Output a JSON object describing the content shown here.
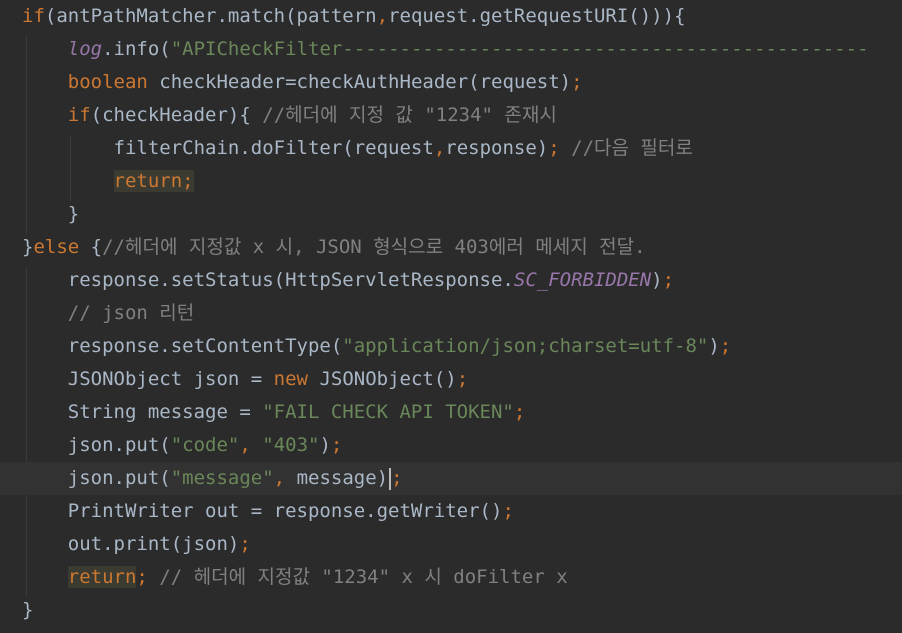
{
  "code_editor": {
    "lines": [
      {
        "tokens": [
          {
            "t": "if",
            "c": "kw"
          },
          {
            "t": "(antPathMatcher.match(pattern",
            "c": ""
          },
          {
            "t": ",",
            "c": "punct"
          },
          {
            "t": "request.getRequestURI())){",
            "c": ""
          }
        ]
      },
      {
        "tokens": [
          {
            "t": "    "
          },
          {
            "t": "log",
            "c": "fld"
          },
          {
            "t": ".info("
          },
          {
            "t": "\"APICheckFilter----------------------------------------------",
            "c": "str"
          }
        ]
      },
      {
        "tokens": [
          {
            "t": "    "
          },
          {
            "t": "boolean",
            "c": "kw"
          },
          {
            "t": " checkHeader=checkAuthHeader(request)"
          },
          {
            "t": ";",
            "c": "punct"
          }
        ]
      },
      {
        "tokens": [
          {
            "t": "    "
          },
          {
            "t": "if",
            "c": "kw"
          },
          {
            "t": "(checkHeader){ "
          },
          {
            "t": "//헤더에 지정 값 \"1234\" 존재시",
            "c": "cm"
          }
        ]
      },
      {
        "tokens": [
          {
            "t": "        filterChain.doFilter(request"
          },
          {
            "t": ",",
            "c": "punct"
          },
          {
            "t": "response)"
          },
          {
            "t": ";",
            "c": "punct"
          },
          {
            "t": " "
          },
          {
            "t": "//다음 필터로",
            "c": "cm"
          }
        ]
      },
      {
        "tokens": [
          {
            "t": "        "
          },
          {
            "t": "return",
            "c": "kw hl"
          },
          {
            "t": ";",
            "c": "punct hl"
          }
        ]
      },
      {
        "tokens": [
          {
            "t": "    }"
          }
        ]
      },
      {
        "tokens": [
          {
            "t": "}"
          },
          {
            "t": "else",
            "c": "kw"
          },
          {
            "t": " {"
          },
          {
            "t": "//헤더에 지정값 x 시, JSON 형식으로 403에러 메세지 전달.",
            "c": "cm"
          }
        ]
      },
      {
        "tokens": [
          {
            "t": "    response.setStatus(HttpServletResponse."
          },
          {
            "t": "SC_FORBIDDEN",
            "c": "fld"
          },
          {
            "t": ")"
          },
          {
            "t": ";",
            "c": "punct"
          }
        ]
      },
      {
        "tokens": [
          {
            "t": "    "
          },
          {
            "t": "// json 리턴",
            "c": "cm"
          }
        ]
      },
      {
        "tokens": [
          {
            "t": "    response.setContentType("
          },
          {
            "t": "\"application/json;charset=utf-8\"",
            "c": "str"
          },
          {
            "t": ")"
          },
          {
            "t": ";",
            "c": "punct"
          }
        ]
      },
      {
        "tokens": [
          {
            "t": "    JSONObject json = "
          },
          {
            "t": "new",
            "c": "kw"
          },
          {
            "t": " JSONObject()"
          },
          {
            "t": ";",
            "c": "punct"
          }
        ]
      },
      {
        "tokens": [
          {
            "t": "    String message = "
          },
          {
            "t": "\"FAIL CHECK API TOKEN\"",
            "c": "str"
          },
          {
            "t": ";",
            "c": "punct"
          }
        ]
      },
      {
        "tokens": [
          {
            "t": "    json.put("
          },
          {
            "t": "\"code\"",
            "c": "str"
          },
          {
            "t": ", ",
            "c": "punct"
          },
          {
            "t": "\"403\"",
            "c": "str"
          },
          {
            "t": ")"
          },
          {
            "t": ";",
            "c": "punct"
          }
        ]
      },
      {
        "current": true,
        "tokens": [
          {
            "t": "    json.put("
          },
          {
            "t": "\"message\"",
            "c": "str"
          },
          {
            "t": ", ",
            "c": "punct"
          },
          {
            "t": "message)"
          },
          {
            "t": ";",
            "c": "punct"
          }
        ]
      },
      {
        "tokens": [
          {
            "t": "    PrintWriter out = response.getWriter()"
          },
          {
            "t": ";",
            "c": "punct"
          }
        ]
      },
      {
        "tokens": [
          {
            "t": "    out.print(json)"
          },
          {
            "t": ";",
            "c": "punct"
          }
        ]
      },
      {
        "tokens": [
          {
            "t": "    "
          },
          {
            "t": "return",
            "c": "kw hl"
          },
          {
            "t": ";",
            "c": "punct"
          },
          {
            "t": " "
          },
          {
            "t": "// 헤더에 지정값 \"1234\" x 시 doFilter x",
            "c": "cm"
          }
        ]
      },
      {
        "tokens": [
          {
            "t": "}"
          }
        ]
      }
    ]
  }
}
